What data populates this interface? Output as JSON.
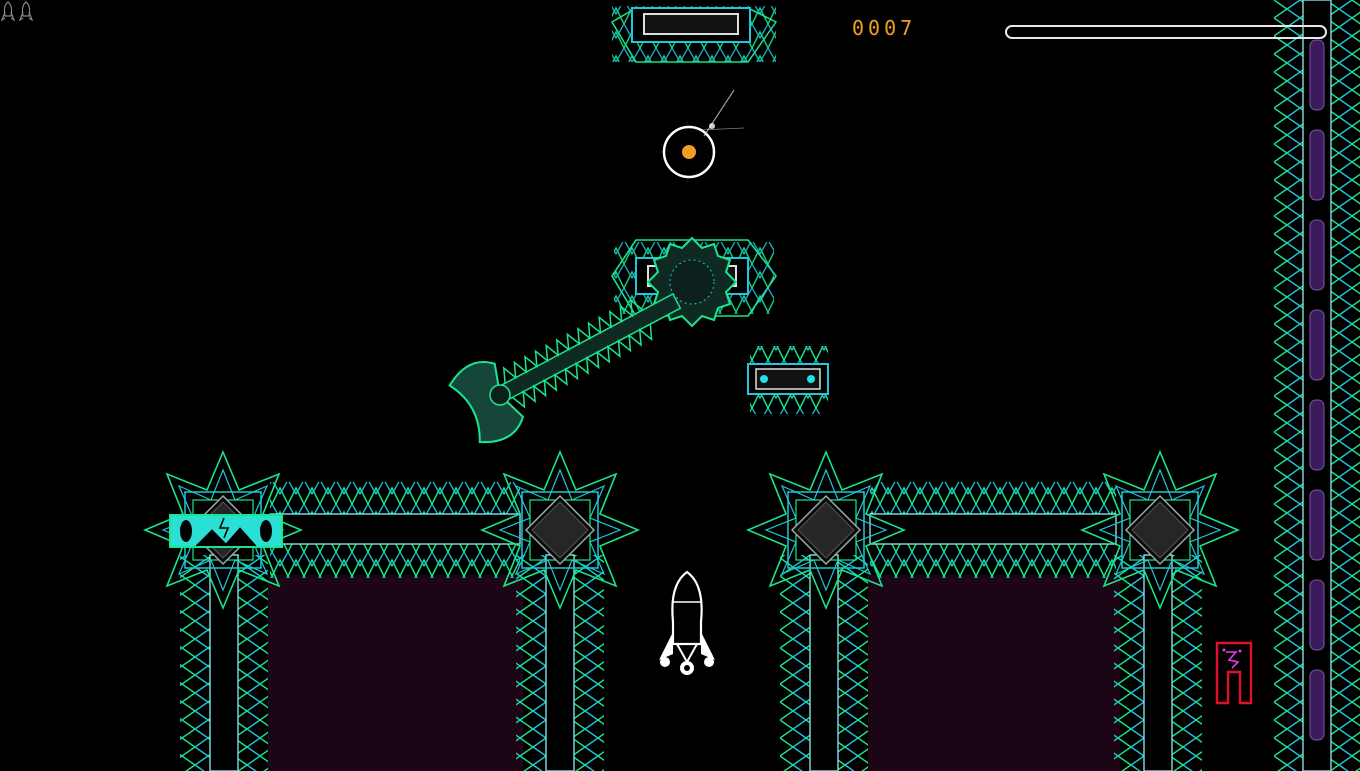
{
  "hud": {
    "score": "0007",
    "progress": 0.0,
    "lives_remaining": 2
  },
  "colors": {
    "background": "#000000",
    "spike_green": "#19e68c",
    "spike_cyan": "#1fc8d8",
    "panel_fill": "#1c0514",
    "accent_orange": "#f0a020",
    "player_white": "#ffffff",
    "exit_red": "#e0102a",
    "exit_magenta": "#e040e0",
    "rail_purple": "#3a1a5a"
  },
  "entities": {
    "player": "rocket-ship",
    "orb": "orange-orb-with-ring",
    "hazard_axe": "spinning-saw-axe",
    "exit": "red-exit-portal",
    "switch": "cyan-power-switch"
  }
}
